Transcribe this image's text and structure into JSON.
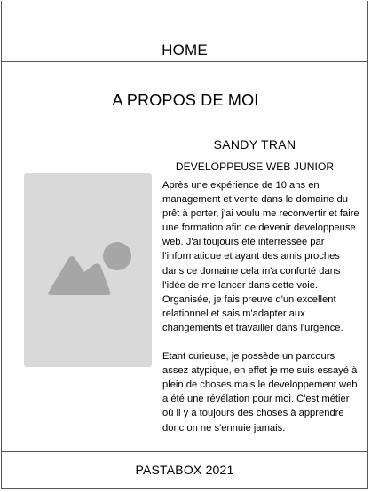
{
  "header": {
    "nav_home": "HOME"
  },
  "main": {
    "title": "A PROPOS DE MOI",
    "name": "SANDY TRAN",
    "job_title": "DEVELOPPEUSE WEB JUNIOR",
    "photo_icon": "image-placeholder-icon",
    "bio_paragraphs": [
      "Après une expérience de 10 ans en management et vente dans le domaine du prêt à porter, j'ai voulu me reconvertir et faire une formation afin de devenir developpeuse web. J'ai toujours été interressée par l'informatique et ayant des amis proches dans ce domaine cela m'a conforté dans l'idée de me lancer dans cette voie. Organisée, je fais preuve d'un excellent relationnel et sais m'adapter aux changements et travailler dans l'urgence.",
      "Etant curieuse, je possède un parcours assez atypique, en effet je me suis essayé à plein de choses mais le developpement web a été une révélation pour moi. C'est métier où il y a toujours des choses à apprendre donc on ne s'ennuie jamais."
    ]
  },
  "footer": {
    "text": "PASTABOX 2021"
  },
  "colors": {
    "border": "#555555",
    "placeholder_bg": "#d9d9d9",
    "placeholder_icon": "#a6a6a6"
  }
}
